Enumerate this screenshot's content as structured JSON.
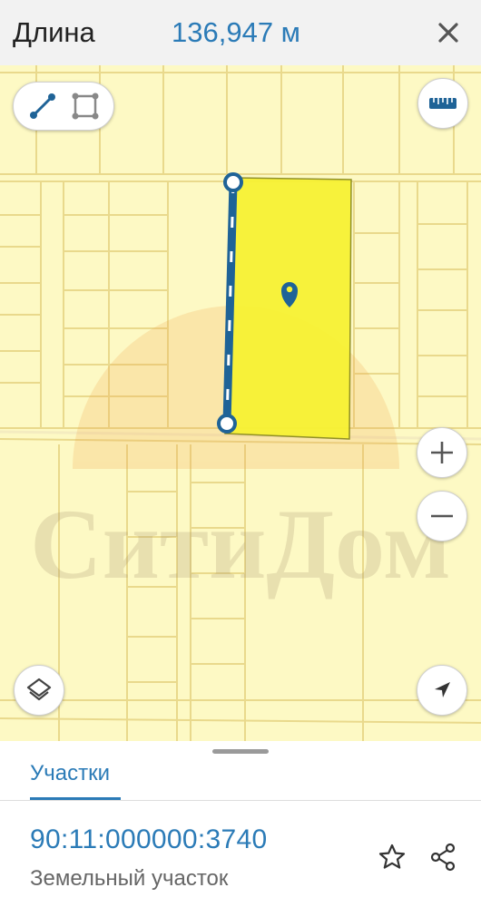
{
  "header": {
    "title": "Длина",
    "measurement": "136,947 м",
    "close_icon": "close-icon"
  },
  "map": {
    "tools": {
      "line_icon": "measure-line-icon",
      "area_icon": "measure-area-icon",
      "ruler_icon": "ruler-icon",
      "zoom_in_icon": "plus-icon",
      "zoom_out_icon": "minus-icon",
      "layers_icon": "layers-icon",
      "location_icon": "navigation-arrow-icon"
    },
    "watermark": "СитиДом",
    "colors": {
      "background": "#fdf9c4",
      "parcel_lines": "#e9d98c",
      "selected_parcel": "#f7f234",
      "measure_line": "#1f6397",
      "accent": "#2b7bb7"
    }
  },
  "sheet": {
    "tab_label": "Участки",
    "parcel_id": "90:11:000000:3740",
    "parcel_type": "Земельный участок",
    "favorite_icon": "star-icon",
    "share_icon": "share-icon"
  }
}
